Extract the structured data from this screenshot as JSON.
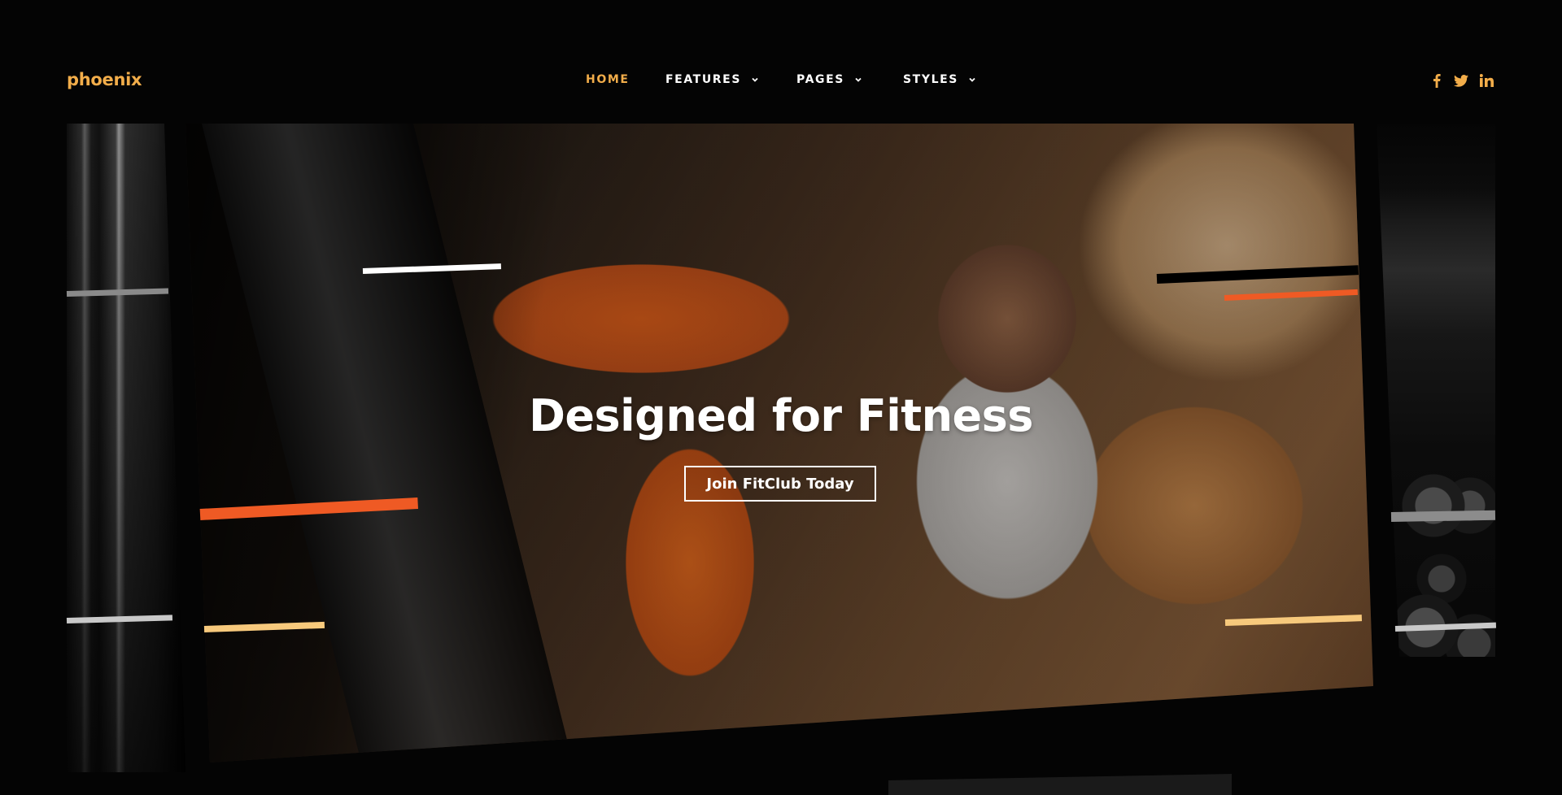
{
  "brand": {
    "logo_text": "phoenix"
  },
  "nav": {
    "items": [
      {
        "label": "HOME",
        "active": true,
        "has_dropdown": false
      },
      {
        "label": "FEATURES",
        "active": false,
        "has_dropdown": true
      },
      {
        "label": "PAGES",
        "active": false,
        "has_dropdown": true
      },
      {
        "label": "STYLES",
        "active": false,
        "has_dropdown": true
      }
    ]
  },
  "social": {
    "icons": [
      "facebook-icon",
      "twitter-icon",
      "linkedin-icon"
    ],
    "color": "#f2ad4a"
  },
  "hero": {
    "title": "Designed for Fitness",
    "cta_label": "Join FitClub Today"
  },
  "colors": {
    "accent": "#f2ad4a",
    "orange": "#ef5a24",
    "background": "#040404",
    "white": "#ffffff"
  }
}
